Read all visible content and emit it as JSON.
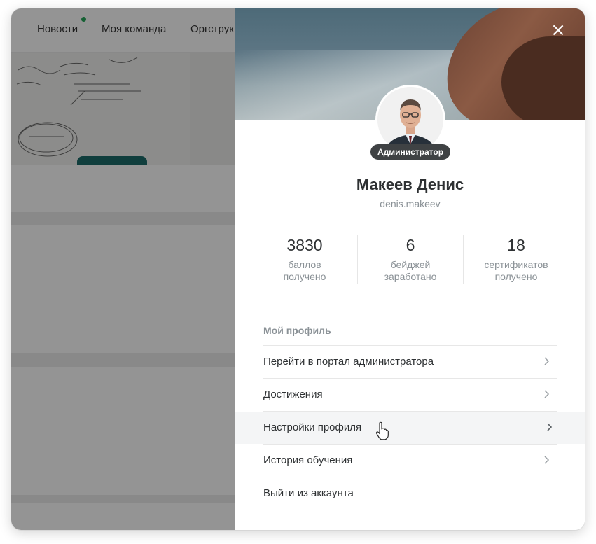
{
  "nav": {
    "items": [
      "Новости",
      "Моя команда",
      "Оргструк"
    ],
    "accent_color": "#27a85a"
  },
  "profile": {
    "close_icon": "close-icon",
    "role": "Администратор",
    "name": "Макеев Денис",
    "login": "denis.makeev",
    "stats": [
      {
        "value": "3830",
        "label_line1": "баллов",
        "label_line2": "получено"
      },
      {
        "value": "6",
        "label_line1": "бейджей",
        "label_line2": "заработано"
      },
      {
        "value": "18",
        "label_line1": "сертификатов",
        "label_line2": "получено"
      }
    ],
    "section_title": "Мой профиль",
    "menu": [
      {
        "label": "Перейти в портал администратора",
        "icon": "chevron-right-icon"
      },
      {
        "label": "Достижения",
        "icon": "chevron-right-icon"
      },
      {
        "label": "Настройки профиля",
        "icon": "chevron-right-icon"
      },
      {
        "label": "История обучения",
        "icon": "chevron-right-icon"
      },
      {
        "label": "Выйти из аккаунта"
      }
    ]
  }
}
